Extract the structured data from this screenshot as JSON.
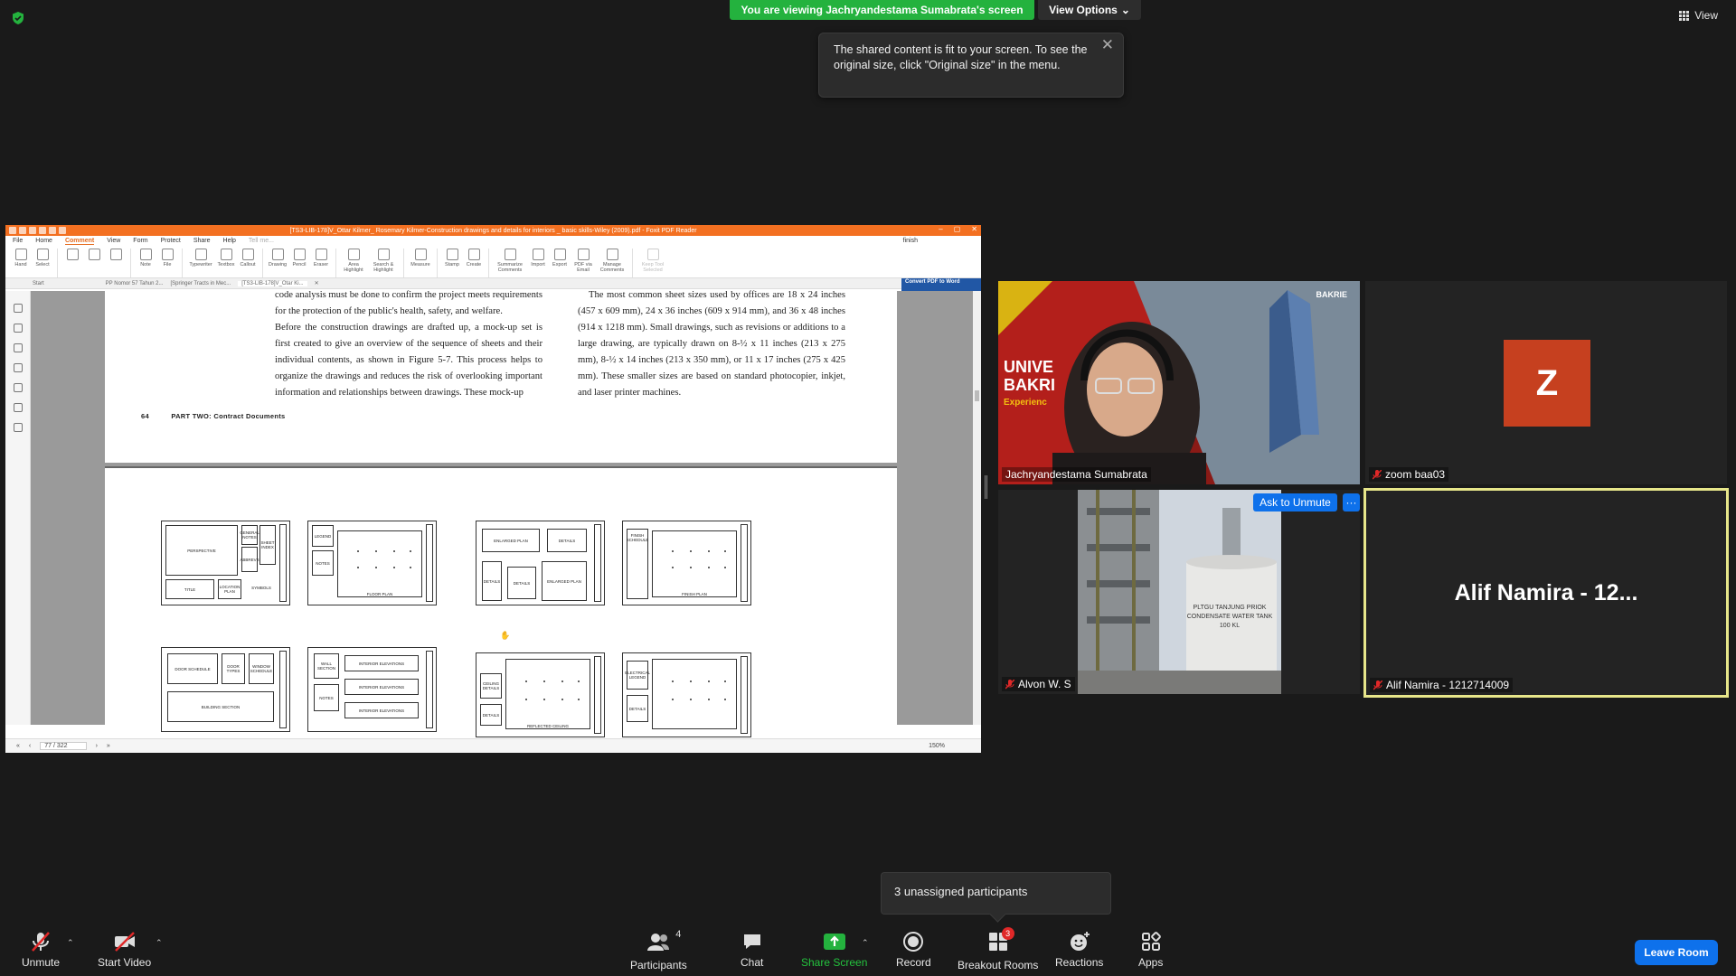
{
  "banner": {
    "viewing": "You are viewing Jachryandestama Sumabrata's screen",
    "view_options": "View Options",
    "view": "View"
  },
  "tooltip": {
    "text": "The shared content is fit to your screen. To see the original size, click \"Original size\" in the menu."
  },
  "shared_screen": {
    "window_title": "[TS3-LIB-178]V_Ottar Kilmer_ Rosemary Kilmer-Construction drawings and details for interiors _ basic skills-Wiley (2009).pdf - Foxit PDF Reader",
    "menu": [
      "File",
      "Home",
      "Comment",
      "View",
      "Form",
      "Protect",
      "Share",
      "Help"
    ],
    "active_menu": "Comment",
    "tell_me": "Tell me...",
    "search_value": "finish",
    "ribbon": [
      "Hand",
      "Select",
      "",
      "",
      "",
      "Note",
      "File",
      "Typewriter",
      "Textbox",
      "Callout",
      "Drawing",
      "Pencil",
      "Eraser",
      "Area Highlight",
      "Search & Highlight",
      "Measure",
      "Stamp",
      "Create",
      "Summarize Comments",
      "Import",
      "Export",
      "PDF via Email",
      "Manage Comments",
      "Keep Tool Selected"
    ],
    "doc_tabs": [
      "Start",
      "PP Nomor 57 Tahun 2...",
      "[Springer Tracts in Mec...",
      "[TS3-LIB-178]V_Otar Ki..."
    ],
    "convert": "Convert PDF to Word",
    "left_col": "code analysis must be done to confirm the project meets requirements for the protection of the public's health, safety, and welfare.\n    Before the construction drawings are drafted up, a mock-up set is first created to give an overview of the sequence of sheets and their individual contents, as shown in Figure 5-7. This process helps to organize the drawings and reduces the risk of overlooking important information and relationships between drawings. These mock-up",
    "right_col": "The most common sheet sizes used by offices are 18 x 24 inches (457 x 609 mm), 24 x 36 inches (609 x 914 mm), and 36 x 48 inches (914 x 1218 mm). Small drawings, such as revisions or additions to a large drawing, are typically drawn on 8-½ x 11 inches (213 x 275 mm), 8-½ x 14 inches (213 x 350 mm), or 11 x 17 inches (275 x 425 mm). These smaller sizes are based on standard photocopier, inkjet, and laser printer machines.",
    "page_number": "64",
    "running_head": "PART TWO: Contract Documents",
    "sheet_labels": {
      "s1": [
        "PERSPECTIVE",
        "GENERAL NOTES",
        "SHEET INDEX",
        "ABBREVS",
        "TITLE",
        "LOCATION PLAN",
        "SYMBOLS"
      ],
      "s2": [
        "LEGEND",
        "NOTES",
        "FLOOR PLAN"
      ],
      "s3": [
        "ENLARGED PLAN",
        "DETAILS",
        "DETAILS",
        "DETAILS",
        "ENLARGED PLAN"
      ],
      "s4": [
        "FINISH SCHEDULE",
        "FINISH PLAN"
      ],
      "s5": [
        "DOOR SCHEDULE",
        "DOOR TYPES",
        "WINDOW SCHEDULE",
        "BUILDING SECTION"
      ],
      "s6": [
        "WALL SECTION",
        "INTERIOR ELEVATIONS",
        "INTERIOR ELEVATIONS",
        "INTERIOR ELEVATIONS",
        "NOTES"
      ],
      "s7": [
        "CEILING DETAILS",
        "DETAILS",
        "REFLECTED CEILING"
      ],
      "s8": [
        "ELECTRICAL LEGEND",
        "DETAILS"
      ]
    },
    "page_indicator": "77 / 322",
    "zoom": "150%"
  },
  "participants_tiles": [
    {
      "name": "Jachryandestama Sumabrata",
      "muted": false,
      "bg_text_1": "UNIVE",
      "bg_text_2": "BAKRI",
      "bg_text_3": "Experienc",
      "logo": "BAKRIE"
    },
    {
      "name": "zoom baa03",
      "muted": true,
      "avatar_letter": "Z"
    },
    {
      "name": "Alvon W. S",
      "muted": true,
      "ask_to_unmute": "Ask to Unmute",
      "more": "···",
      "tank_text": "PLTGU TANJUNG PRIOK CONDENSATE WATER TANK 100 KL"
    },
    {
      "name": "Alif Namira - 1212714009",
      "muted": true,
      "display_name": "Alif Namira - 12..."
    }
  ],
  "unassigned": "3 unassigned participants",
  "toolbar": {
    "unmute": "Unmute",
    "start_video": "Start Video",
    "participants": "Participants",
    "participants_count": "4",
    "chat": "Chat",
    "share_screen": "Share Screen",
    "record": "Record",
    "breakout_rooms": "Breakout Rooms",
    "breakout_badge": "3",
    "reactions": "Reactions",
    "apps": "Apps",
    "leave": "Leave Room"
  },
  "colors": {
    "accent_green": "#24b23e",
    "zoom_blue": "#0e71eb",
    "foxit_orange": "#f37021",
    "avatar_orange": "#c6401f",
    "active_speaker": "#e7e68a"
  }
}
